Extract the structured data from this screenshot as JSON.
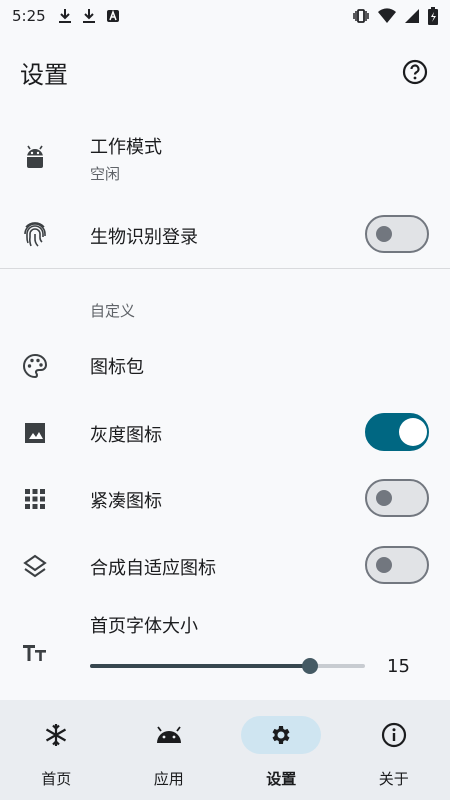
{
  "status": {
    "time": "5:25"
  },
  "appbar": {
    "title": "设置"
  },
  "settings": {
    "work_mode": {
      "label": "工作模式",
      "value": "空闲"
    },
    "biometric": {
      "label": "生物识别登录",
      "enabled": false
    },
    "section_custom": "自定义",
    "icon_pack": {
      "label": "图标包"
    },
    "grayscale": {
      "label": "灰度图标",
      "enabled": true
    },
    "compact": {
      "label": "紧凑图标",
      "enabled": false
    },
    "adaptive": {
      "label": "合成自适应图标",
      "enabled": false
    },
    "font_size": {
      "label": "首页字体大小",
      "value": "15",
      "fraction": 0.8
    }
  },
  "nav": {
    "items": [
      {
        "label": "首页",
        "icon": "snowflake-icon"
      },
      {
        "label": "应用",
        "icon": "android-icon"
      },
      {
        "label": "设置",
        "icon": "gear-icon",
        "active": true
      },
      {
        "label": "关于",
        "icon": "info-icon"
      }
    ]
  },
  "colors": {
    "accent": "#006782",
    "nav_bg": "#eaedf1",
    "active_pill": "#cfe5f1"
  }
}
